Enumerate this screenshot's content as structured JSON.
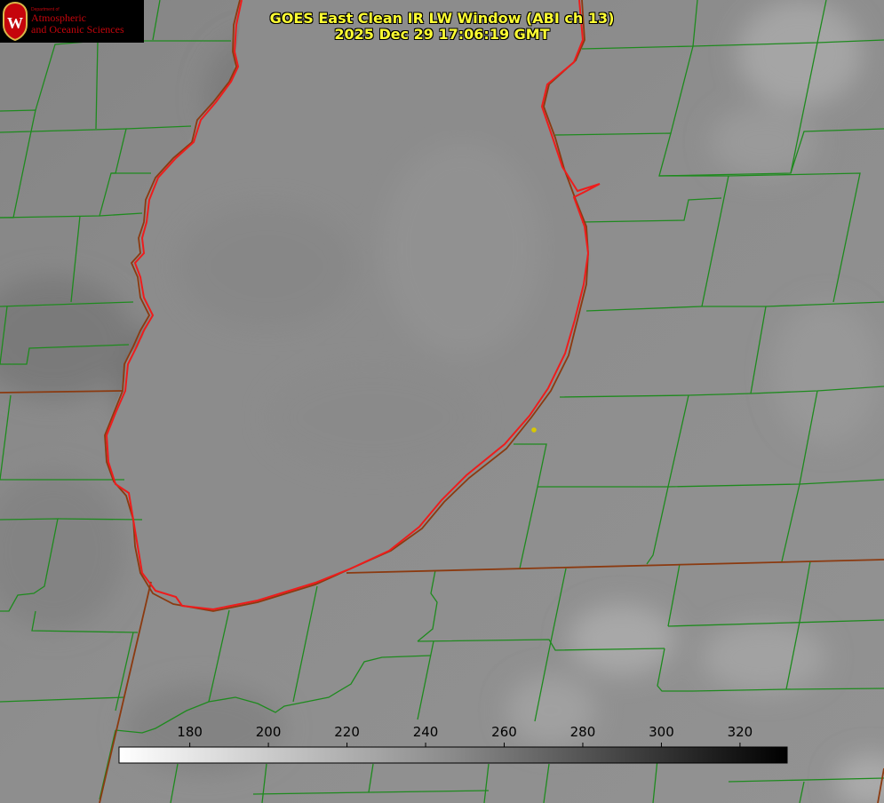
{
  "title": {
    "line1": "GOES East Clean IR LW Window (ABI ch 13)",
    "line2": "2025 Dec 29 17:06:19 GMT"
  },
  "logo": {
    "department": "Department of",
    "line1": "Atmospheric",
    "line2": "and Oceanic Sciences",
    "seal_letter": "W"
  },
  "colorbar": {
    "ticks": [
      "180",
      "200",
      "220",
      "240",
      "260",
      "280",
      "300",
      "320"
    ],
    "tick_values": [
      180,
      200,
      220,
      240,
      260,
      280,
      300,
      320
    ],
    "range": [
      162,
      332
    ],
    "scale": "white (cold) to black (warm)"
  },
  "colors": {
    "county_lines": "#1e8a1e",
    "state_lines": "#8b3a10",
    "lake_outline": "#ee1c1c",
    "station_marker": "#d8c800",
    "title_text": "#ffff33",
    "logo_red": "#c5050c"
  }
}
